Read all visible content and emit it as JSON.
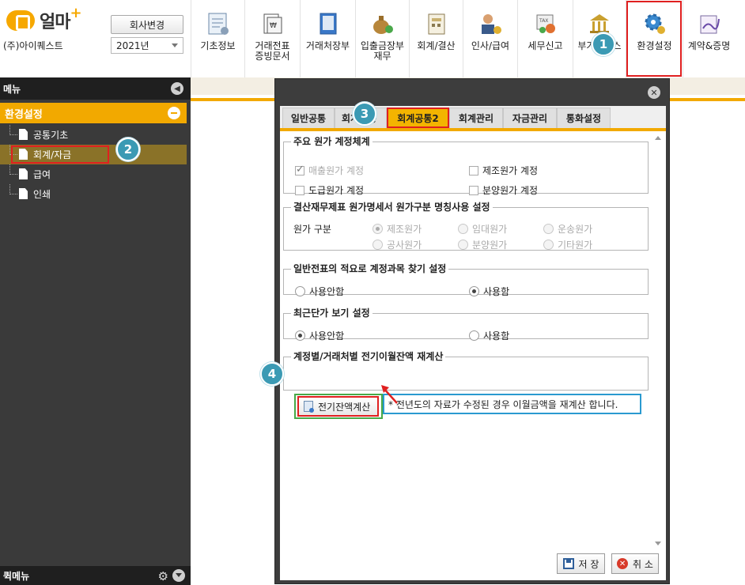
{
  "app": {
    "logo_text": "얼마",
    "logo_plus": "+",
    "company": "(주)아이퀘스트",
    "change_company_label": "회사변경",
    "year_value": "2021년"
  },
  "top_menu": [
    {
      "label": "기초정보",
      "icon": "basic-info-icon"
    },
    {
      "label": "거래전표\n증빙문서",
      "icon": "voucher-icon"
    },
    {
      "label": "거래처장부",
      "icon": "ledger-book-icon"
    },
    {
      "label": "입출금장부\n재무",
      "icon": "money-bag-icon"
    },
    {
      "label": "회계/결산",
      "icon": "accounting-icon"
    },
    {
      "label": "인사/급여",
      "icon": "hr-icon"
    },
    {
      "label": "세무신고",
      "icon": "tax-icon"
    },
    {
      "label": "부가서비스",
      "icon": "bank-icon"
    },
    {
      "label": "환경설정",
      "icon": "gear-icon"
    },
    {
      "label": "계약&증명",
      "icon": "contract-icon"
    }
  ],
  "sidebar": {
    "title": "메뉴",
    "section": "환경설정",
    "items": [
      {
        "label": "공통기초"
      },
      {
        "label": "회계/자금"
      },
      {
        "label": "급여"
      },
      {
        "label": "인쇄"
      }
    ],
    "footer": "퀵메뉴"
  },
  "dialog": {
    "tabs": [
      "일반공통",
      "회계공통",
      "회계공통2",
      "회계관리",
      "자금관리",
      "통화설정"
    ],
    "selected_tab": "회계공통2",
    "groups": {
      "cost_system": {
        "title": "주요 원가 계정체계",
        "options": [
          {
            "label": "매출원가 계정",
            "checked": true,
            "disabled": true
          },
          {
            "label": "제조원가 계정",
            "checked": false,
            "disabled": false
          },
          {
            "label": "도급원가 계정",
            "checked": false,
            "disabled": false
          },
          {
            "label": "분양원가 계정",
            "checked": false,
            "disabled": false
          }
        ]
      },
      "cost_category": {
        "title": "결산재무제표 원가명세서 원가구분 명칭사용 설정",
        "field_label": "원가 구분",
        "options": [
          {
            "label": "제조원가",
            "selected": true
          },
          {
            "label": "임대원가",
            "selected": false
          },
          {
            "label": "운송원가",
            "selected": false
          },
          {
            "label": "공사원가",
            "selected": false
          },
          {
            "label": "분양원가",
            "selected": false
          },
          {
            "label": "기타원가",
            "selected": false
          }
        ]
      },
      "summary_search": {
        "title": "일반전표의 적요로 계정과목 찾기 설정",
        "options": [
          {
            "label": "사용안함",
            "selected": false
          },
          {
            "label": "사용함",
            "selected": true
          }
        ]
      },
      "recent_price": {
        "title": "최근단가 보기 설정",
        "options": [
          {
            "label": "사용안함",
            "selected": true
          },
          {
            "label": "사용함",
            "selected": false
          }
        ]
      },
      "carryover": {
        "title": "계정별/거래처별 전기이월잔액 재계산",
        "button_label": "전기잔액계산",
        "note": "* 전년도의 자료가 수정된 경우 이월금액을 재계산 합니다."
      }
    },
    "save_label": "저 장",
    "cancel_label": "취 소"
  },
  "badges": [
    "1",
    "2",
    "3",
    "4"
  ],
  "colors": {
    "accent": "#f2a900",
    "badge": "#3b9ab4",
    "highlight_red": "#e02020",
    "highlight_green": "#48a948",
    "highlight_blue": "#2a9ad0",
    "sidebar_bg": "#3a3a3a"
  }
}
